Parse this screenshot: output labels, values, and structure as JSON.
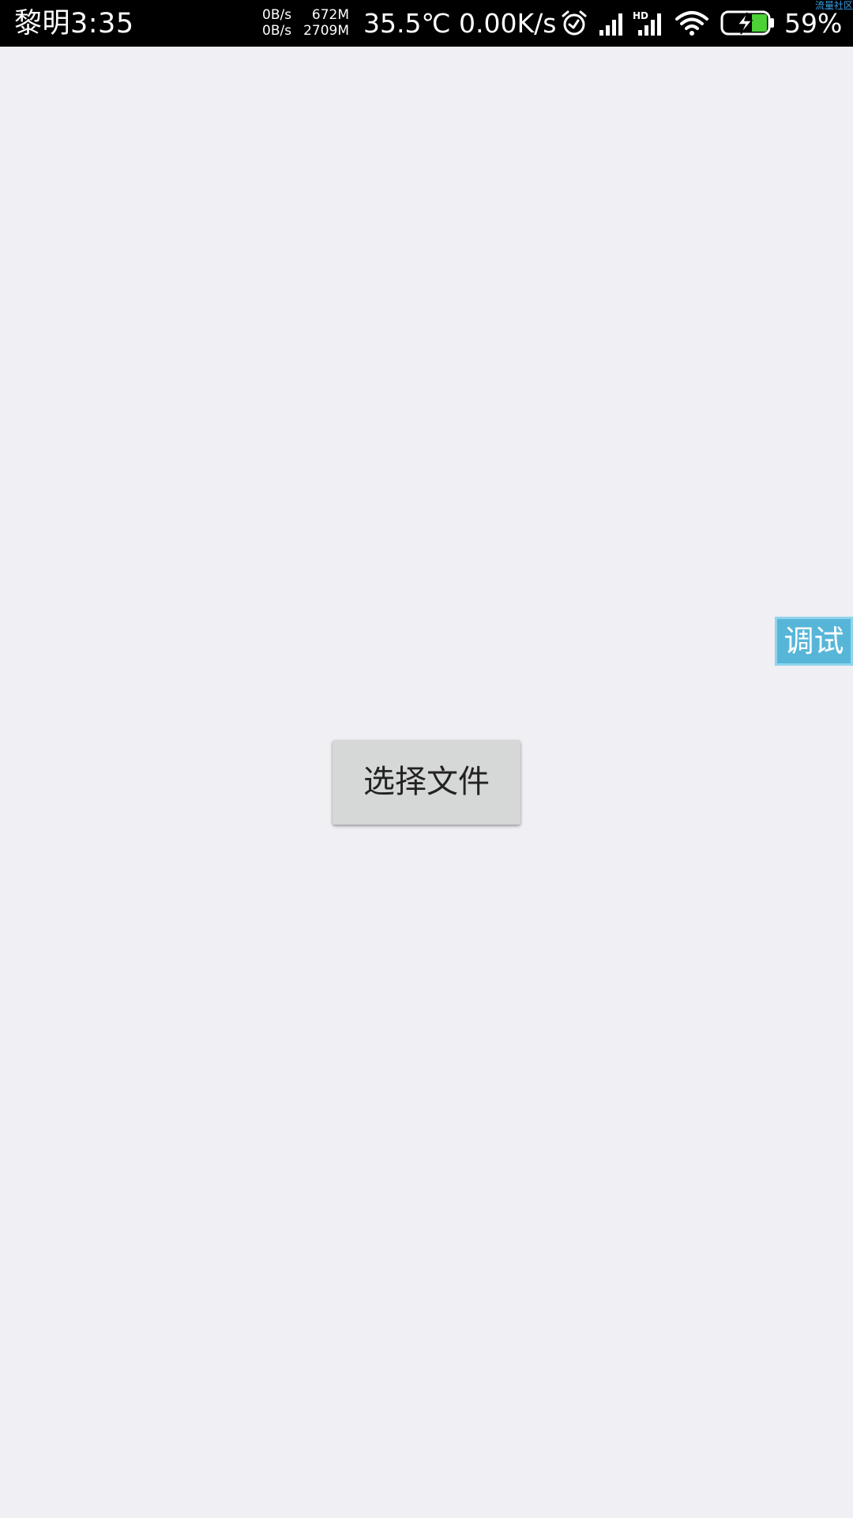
{
  "status_bar": {
    "time": "黎明3:35",
    "net_up": "0B/s",
    "net_down": "0B/s",
    "mem_used": "672M",
    "mem_total": "2709M",
    "temperature": "35.5℃",
    "speed": "0.00K/s",
    "battery_percent": "59%",
    "corner_tag": "流量社区",
    "icons": [
      "alarm-icon",
      "signal-icon",
      "hd-signal-icon",
      "wifi-icon",
      "battery-charging-icon"
    ],
    "battery_fill_color": "#4cd137",
    "signal_hd_label": "HD"
  },
  "debug_tab": {
    "label": "调试",
    "background_color": "#57b6d8"
  },
  "main": {
    "select_file_label": "选择文件"
  }
}
